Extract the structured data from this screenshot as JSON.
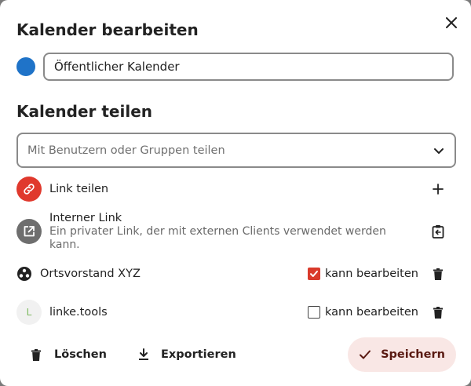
{
  "dialog": {
    "title": "Kalender bearbeiten",
    "close_icon": "close-icon"
  },
  "calendar": {
    "color": "#1f73c8",
    "name": "Öffentlicher Kalender"
  },
  "sharing": {
    "title": "Kalender teilen",
    "search_placeholder": "Mit Benutzern oder Gruppen teilen",
    "link_share": {
      "label": "Link teilen",
      "icon": "link-icon",
      "action_icon": "plus-icon"
    },
    "internal_link": {
      "title": "Interner Link",
      "description_line1": "Ein privater Link, der mit externen Clients verwendet werden",
      "description_line2": "kann.",
      "icon": "open-in-new-icon",
      "action_icon": "clipboard-copy-icon"
    },
    "shares": [
      {
        "name": "Ortsvorstand XYZ",
        "type": "group",
        "can_edit": true,
        "permission_label": "kann bearbeiten"
      },
      {
        "name": "linke.tools",
        "type": "user",
        "avatar_letter": "L",
        "can_edit": false,
        "permission_label": "kann bearbeiten"
      }
    ]
  },
  "footer": {
    "delete_label": "Löschen",
    "export_label": "Exportieren",
    "save_label": "Speichern"
  }
}
